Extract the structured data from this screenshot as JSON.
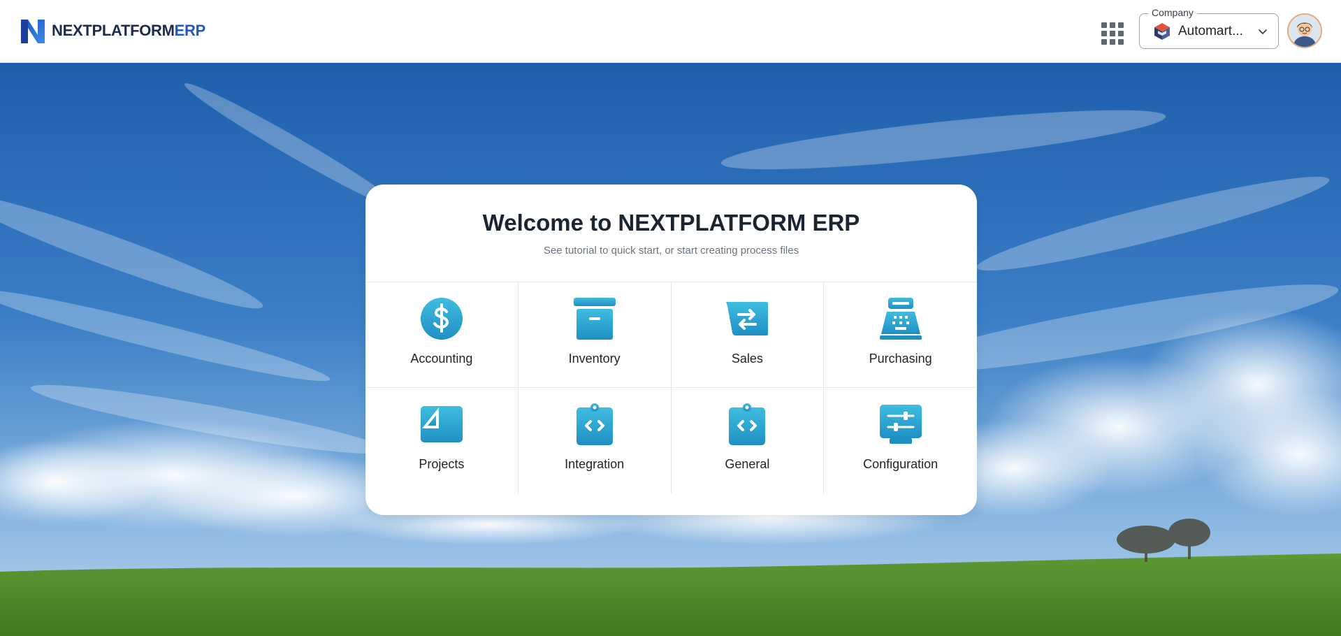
{
  "header": {
    "brand": {
      "name_main": "NEXTPLATFORM",
      "name_accent": "ERP",
      "icon": "logo-n-icon"
    },
    "apps_icon": "apps-grid-icon",
    "company": {
      "label": "Company",
      "value": "Automart...",
      "icon": "company-logo-icon",
      "dropdown_icon": "chevron-down-icon"
    },
    "avatar_icon": "user-avatar"
  },
  "welcome": {
    "title": "Welcome to NEXTPLATFORM ERP",
    "subtitle": "See tutorial to quick start, or start creating process files"
  },
  "modules": [
    {
      "label": "Accounting",
      "icon": "dollar-coin-icon"
    },
    {
      "label": "Inventory",
      "icon": "archive-box-icon"
    },
    {
      "label": "Sales",
      "icon": "exchange-arrows-icon"
    },
    {
      "label": "Purchasing",
      "icon": "cash-register-icon"
    },
    {
      "label": "Projects",
      "icon": "drafting-triangle-icon"
    },
    {
      "label": "Integration",
      "icon": "code-clipboard-icon"
    },
    {
      "label": "General",
      "icon": "code-clipboard-icon"
    },
    {
      "label": "Configuration",
      "icon": "sliders-settings-icon"
    }
  ],
  "colors": {
    "brand_dark": "#1d2b4f",
    "brand_accent": "#2457c5",
    "icon_gradient_top": "#3fbde0",
    "icon_gradient_bottom": "#1f8fc4",
    "sky": "#2f6fb8",
    "grass": "#4f8f2a"
  }
}
